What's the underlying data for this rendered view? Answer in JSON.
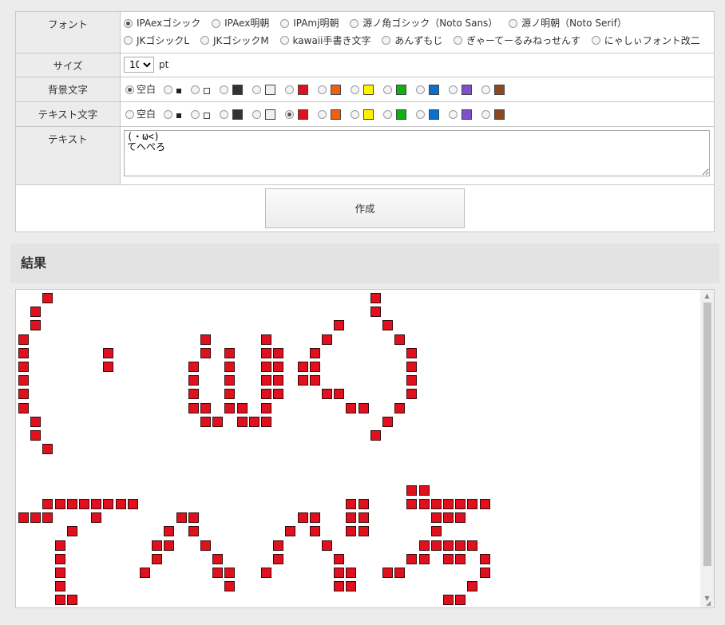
{
  "form": {
    "font_label": "フォント",
    "fonts_row1": [
      "IPAexゴシック",
      "IPAex明朝",
      "IPAmj明朝",
      "源ノ角ゴシック（Noto Sans）",
      "源ノ明朝（Noto Serif）"
    ],
    "fonts_row2": [
      "JKゴシックL",
      "JKゴシックM",
      "kawaii手書き文字",
      "あんずもじ",
      "ぎゃーてーるみねっせんす",
      "にゃしぃフォント改二"
    ],
    "selected_font": "IPAexゴシック",
    "size_label": "サイズ",
    "size_value": "10",
    "size_unit": "pt",
    "bg_label": "背景文字",
    "text_color_label": "テキスト文字",
    "blank_label": "空白",
    "colors": [
      "#222222",
      "#ffffff",
      "#333333",
      "#f0f0f0",
      "#e0101e",
      "#f06010",
      "#fff000",
      "#10b010",
      "#0a70d0",
      "#8050c8",
      "#8a4a20"
    ],
    "bg_selected": "空白",
    "text_selected_color": "#e0101e",
    "text_label": "テキスト",
    "text_value": "(・ω<)\nてへぺろ",
    "make_button": "作成"
  },
  "result": {
    "heading": "結果",
    "pixel_color": "#e0101e"
  }
}
